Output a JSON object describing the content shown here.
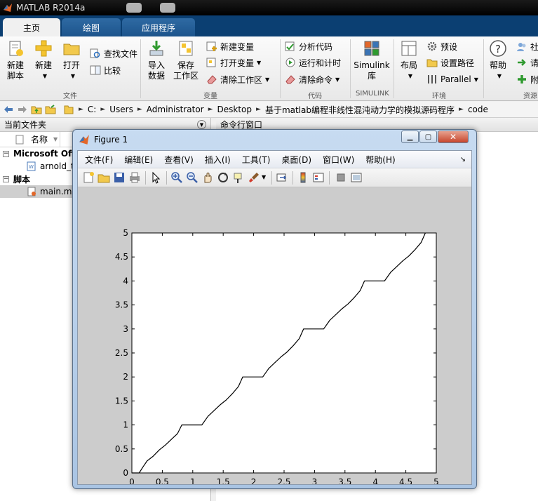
{
  "app": {
    "title": "MATLAB R2014a"
  },
  "tabs": [
    {
      "label": "主页",
      "active": true
    },
    {
      "label": "绘图",
      "active": false
    },
    {
      "label": "应用程序",
      "active": false
    }
  ],
  "ribbon": {
    "file": {
      "label": "文件",
      "new_script": "新建\n脚本",
      "new": "新建",
      "open": "打开",
      "find_files": "查找文件",
      "compare": "比较"
    },
    "variable": {
      "label": "变量",
      "import_data": "导入\n数据",
      "save_workspace": "保存\n工作区",
      "new_variable": "新建变量",
      "open_variable": "打开变量",
      "clear_workspace": "清除工作区"
    },
    "code": {
      "label": "代码",
      "analyze_code": "分析代码",
      "run_and_time": "运行和计时",
      "clear_commands": "清除命令"
    },
    "simulink": {
      "label": "SIMULINK",
      "button": "Simulink\n库"
    },
    "environment": {
      "label": "环境",
      "layout": "布局",
      "preferences": "预设",
      "set_path": "设置路径",
      "parallel": "Parallel"
    },
    "resources": {
      "label": "资源",
      "help": "帮助",
      "community": "社",
      "request": "请",
      "addons": "附"
    }
  },
  "address": {
    "crumbs": [
      "C:",
      "Users",
      "Administrator",
      "Desktop",
      "基于matlab编程非线性混沌动力学的模拟源码程序",
      "code"
    ]
  },
  "left_panel": {
    "title": "当前文件夹",
    "column": "名称",
    "groups": [
      {
        "label": "Microsoft Off",
        "items": [
          "arnold_t"
        ]
      },
      {
        "label": "脚本",
        "items": [
          "main.m"
        ]
      }
    ]
  },
  "right_panel": {
    "title": "命令行窗口"
  },
  "figure": {
    "title": "Figure 1",
    "menu": [
      "文件(F)",
      "编辑(E)",
      "查看(V)",
      "插入(I)",
      "工具(T)",
      "桌面(D)",
      "窗口(W)",
      "帮助(H)"
    ]
  },
  "chart_data": {
    "type": "line",
    "title": "",
    "xlabel": "",
    "ylabel": "",
    "xlim": [
      0,
      5
    ],
    "ylim": [
      0,
      5
    ],
    "xticks": [
      "0",
      "0.5",
      "1",
      "1.5",
      "2",
      "2.5",
      "3",
      "3.5",
      "4",
      "4.5",
      "5"
    ],
    "yticks": [
      "0",
      "0.5",
      "1",
      "1.5",
      "2",
      "2.5",
      "3",
      "3.5",
      "4",
      "4.5",
      "5"
    ],
    "grid": false,
    "series": [
      {
        "color": "#000000",
        "x": [
          0,
          0.12,
          0.18,
          0.25,
          0.35,
          0.45,
          0.55,
          0.65,
          0.75,
          0.82,
          1.15,
          1.25,
          1.35,
          1.45,
          1.55,
          1.65,
          1.75,
          1.82,
          2.15,
          2.25,
          2.35,
          2.45,
          2.55,
          2.65,
          2.75,
          2.82,
          3.15,
          3.25,
          3.35,
          3.45,
          3.55,
          3.65,
          3.75,
          3.82,
          4.15,
          4.25,
          4.35,
          4.45,
          4.55,
          4.65,
          4.75,
          4.82
        ],
        "y": [
          0,
          0,
          0.12,
          0.25,
          0.35,
          0.48,
          0.58,
          0.7,
          0.82,
          1.0,
          1.0,
          1.18,
          1.3,
          1.42,
          1.52,
          1.65,
          1.8,
          2.0,
          2.0,
          2.18,
          2.3,
          2.42,
          2.52,
          2.65,
          2.8,
          3.0,
          3.0,
          3.18,
          3.3,
          3.42,
          3.52,
          3.65,
          3.8,
          4.0,
          4.0,
          4.18,
          4.3,
          4.42,
          4.52,
          4.65,
          4.8,
          5.0
        ]
      }
    ]
  }
}
